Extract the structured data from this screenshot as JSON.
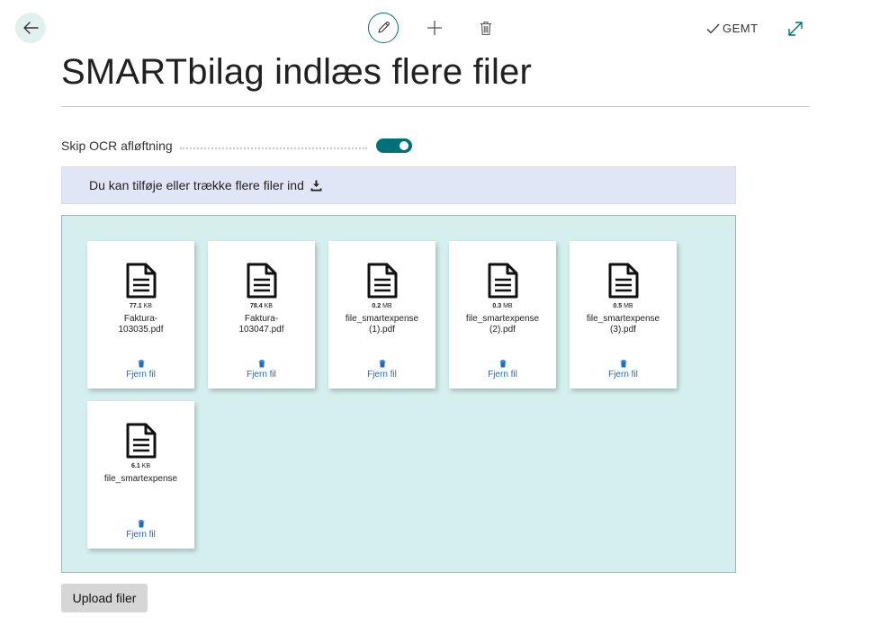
{
  "header": {
    "saved_label": "GEMT"
  },
  "page": {
    "title": "SMARTbilag indlæs flere filer"
  },
  "field": {
    "label": "Skip OCR afløftning",
    "toggle_on": true
  },
  "info": {
    "text": "Du kan tilføje eller trække flere filer ind"
  },
  "files": [
    {
      "size_value": "77.1",
      "size_unit": "KB",
      "name_line1": "Faktura-",
      "name_line2": "103035.pdf",
      "remove_label": "Fjern fil"
    },
    {
      "size_value": "78.4",
      "size_unit": "KB",
      "name_line1": "Faktura-",
      "name_line2": "103047.pdf",
      "remove_label": "Fjern fil"
    },
    {
      "size_value": "0.2",
      "size_unit": "MB",
      "name_line1": "file_smartexpense",
      "name_line2": "(1).pdf",
      "remove_label": "Fjern fil"
    },
    {
      "size_value": "0.3",
      "size_unit": "MB",
      "name_line1": "file_smartexpense",
      "name_line2": "(2).pdf",
      "remove_label": "Fjern fil"
    },
    {
      "size_value": "0.5",
      "size_unit": "MB",
      "name_line1": "file_smartexpense",
      "name_line2": "(3).pdf",
      "remove_label": "Fjern fil"
    },
    {
      "size_value": "6.1",
      "size_unit": "KB",
      "name_line1": "file_smartexpense",
      "name_line2": "",
      "remove_label": "Fjern fil"
    }
  ],
  "upload": {
    "label": "Upload filer"
  },
  "colors": {
    "accent": "#00707a",
    "dropzone": "#d5efee",
    "info_bar": "#e1e6f7",
    "link": "#1a6ec0"
  }
}
